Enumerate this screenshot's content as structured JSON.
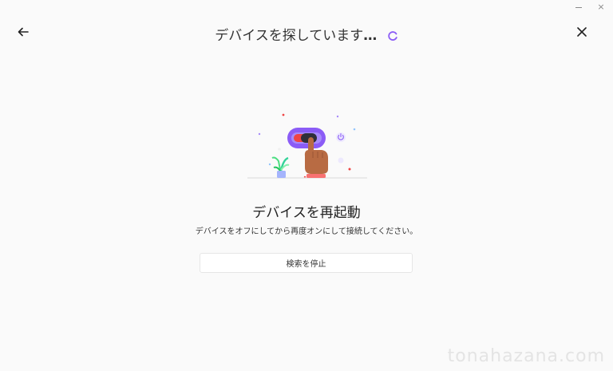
{
  "window": {
    "minimize_label": "–",
    "close_label": "×"
  },
  "header": {
    "title": "デバイスを探しています",
    "title_dots": "…"
  },
  "main": {
    "heading": "デバイスを再起動",
    "instruction": "デバイスをオフにしてから再度オンにして接続してください。",
    "stop_button_label": "検索を停止"
  },
  "watermark": "tonahazana.com",
  "colors": {
    "accent_purple": "#8b5cf6",
    "toggle_red": "#ef4444",
    "plant_green": "#4ade80",
    "background": "#fafafa"
  }
}
